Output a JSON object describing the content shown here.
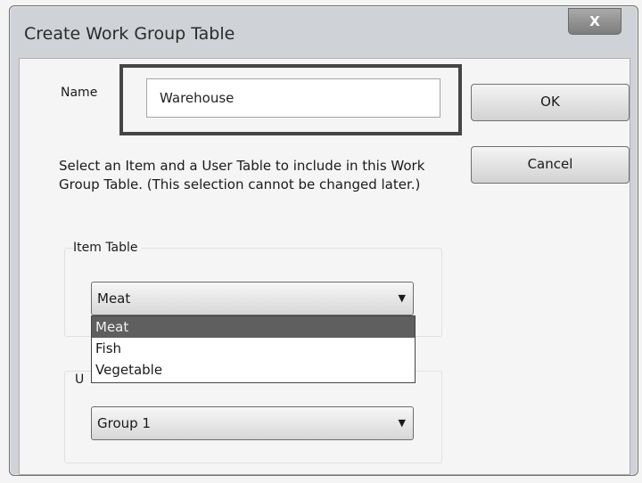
{
  "window": {
    "title": "Create Work Group Table",
    "close_glyph": "X",
    "close_icon": "close-icon"
  },
  "name": {
    "label": "Name",
    "value": "Warehouse"
  },
  "buttons": {
    "ok": "OK",
    "cancel": "Cancel"
  },
  "description": "Select an Item and a User Table to include in this Work Group Table. (This selection cannot be changed later.)",
  "item_table": {
    "label": "Item Table",
    "selected": "Meat",
    "options": [
      "Meat",
      "Fish",
      "Vegetable"
    ],
    "arrow_icon": "dropdown-arrow-icon"
  },
  "user_table": {
    "label": "U",
    "selected": "Group 1",
    "arrow_icon": "dropdown-arrow-icon"
  },
  "colors": {
    "selection_highlight": "#5f5f5f",
    "frame": "#cfd2d6"
  }
}
